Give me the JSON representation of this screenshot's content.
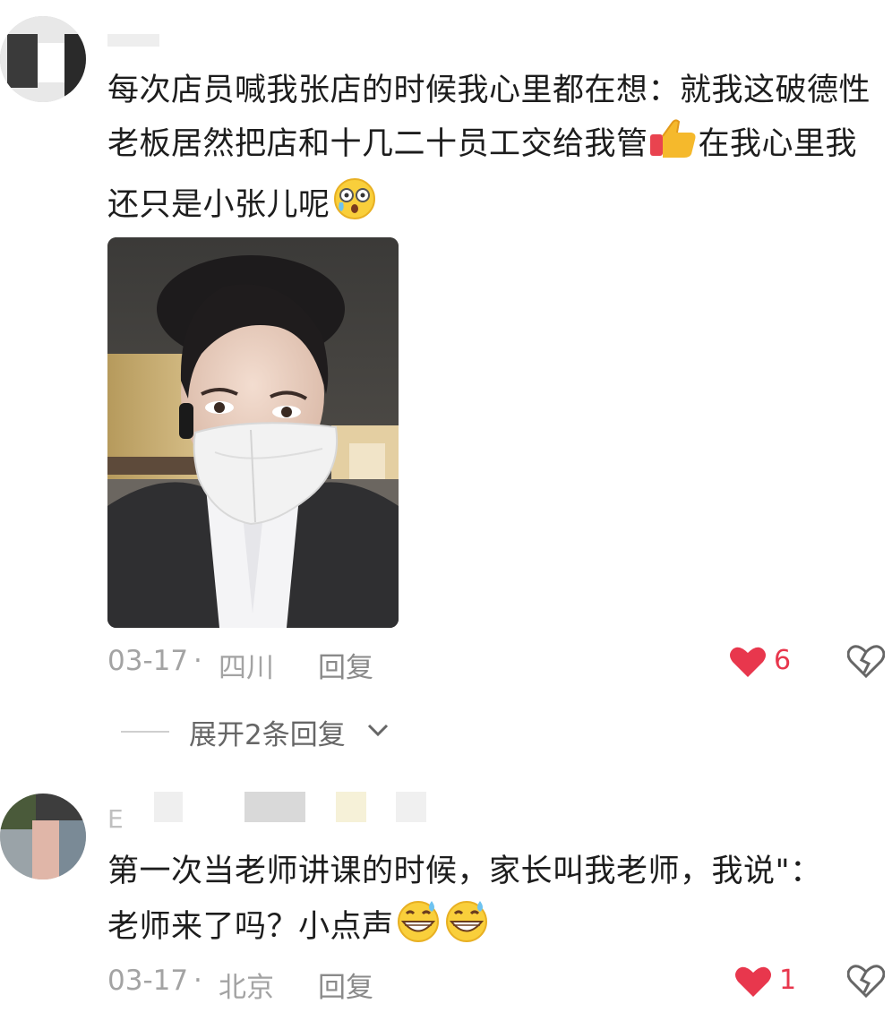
{
  "comments": [
    {
      "username": "",
      "text_parts": [
        "每次店员喊我张店的时候我心里都在想：就我这破德性老板居然把店和十几二十员工交给我管",
        "在我心里我还只是小张儿呢"
      ],
      "emoji_after_part1": "thumbs-up",
      "emoji_end": "astonished-face",
      "date": "03-17",
      "separator": "·",
      "location": "四川",
      "reply_label": "回复",
      "like_count": "6",
      "liked": true,
      "expand_replies_label": "展开2条回复"
    },
    {
      "username": "E",
      "text": "第一次当老师讲课的时候，家长叫我老师，我说\"：老师来了吗？小点声",
      "emoji_end": "grinning-sweat-face",
      "date": "03-17",
      "separator": "·",
      "location": "北京",
      "reply_label": "回复",
      "like_count": "1",
      "liked": true
    }
  ],
  "colors": {
    "like_red": "#e8374d",
    "meta_gray": "#a3a3a3",
    "text_dark": "#1d1d1d"
  }
}
